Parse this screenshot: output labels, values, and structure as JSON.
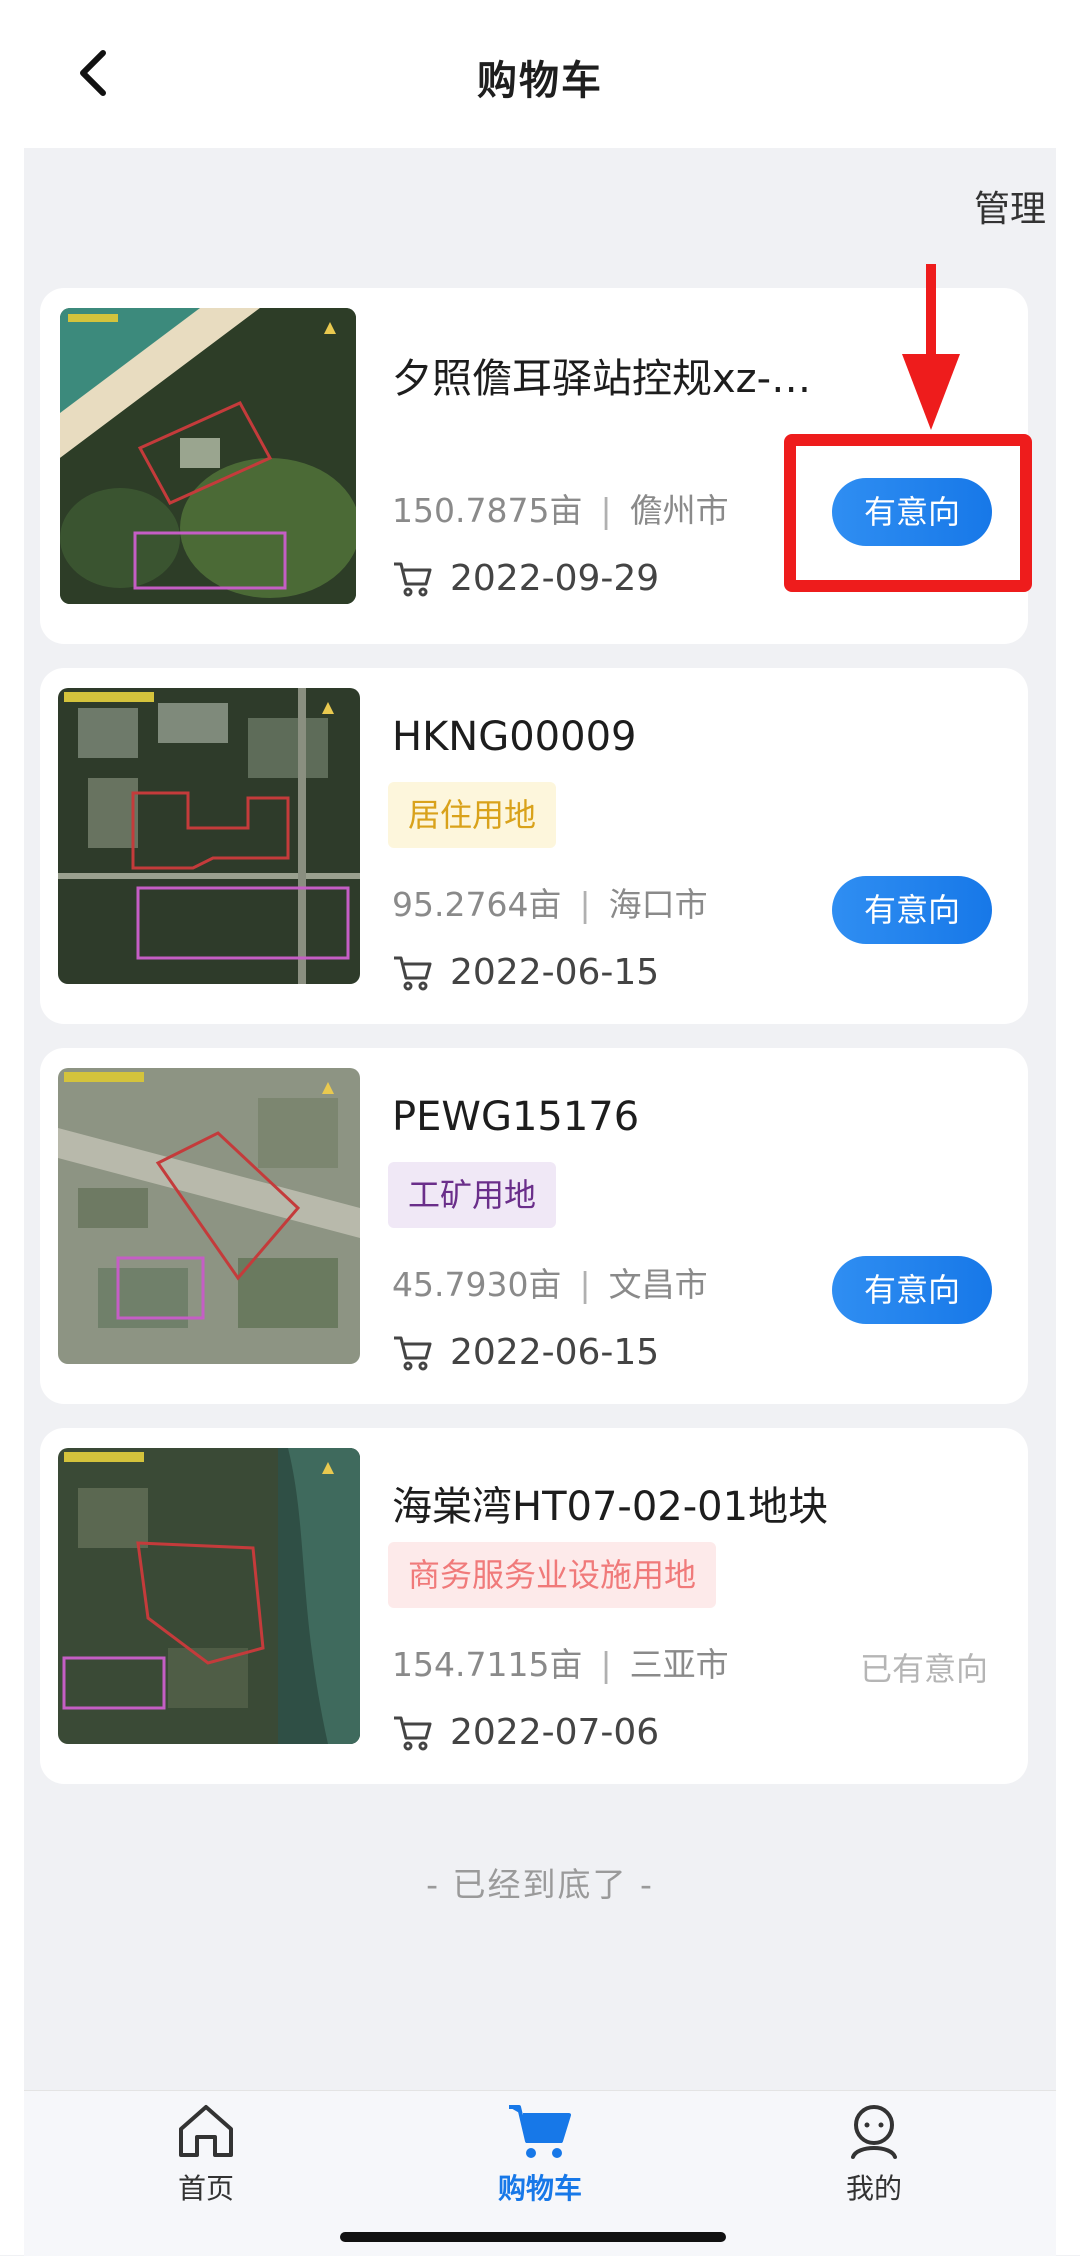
{
  "header": {
    "title": "购物车",
    "manage_label": "管理"
  },
  "items": [
    {
      "title": "夕照儋耳驿站控规xz-…",
      "area": "150.7875亩",
      "city": "儋州市",
      "date": "2022-09-29",
      "action": "有意向"
    },
    {
      "title": "HKNG00009",
      "tag": "居住用地",
      "area": "95.2764亩",
      "city": "海口市",
      "date": "2022-06-15",
      "action": "有意向"
    },
    {
      "title": "PEWG15176",
      "tag": "工矿用地",
      "area": "45.7930亩",
      "city": "文昌市",
      "date": "2022-06-15",
      "action": "有意向"
    },
    {
      "title": "海棠湾HT07-02-01地块",
      "tag": "商务服务业设施用地",
      "area": "154.7115亩",
      "city": "三亚市",
      "date": "2022-07-06",
      "status": "已有意向"
    }
  ],
  "list_end_text": "- 已经到底了 -",
  "tabs": [
    {
      "label": "首页",
      "icon": "home-icon",
      "active": false
    },
    {
      "label": "购物车",
      "icon": "cart-icon",
      "active": true
    },
    {
      "label": "我的",
      "icon": "profile-icon",
      "active": false
    }
  ],
  "colors": {
    "accent": "#1778e8",
    "tag_residential_bg": "#fdf6dc",
    "tag_residential_fg": "#d9a21b",
    "tag_industrial_bg": "#f0e8f6",
    "tag_industrial_fg": "#6a2e8a",
    "tag_commercial_bg": "#fdeaea",
    "tag_commercial_fg": "#f07a7a",
    "annotation": "#ee1c1c"
  }
}
